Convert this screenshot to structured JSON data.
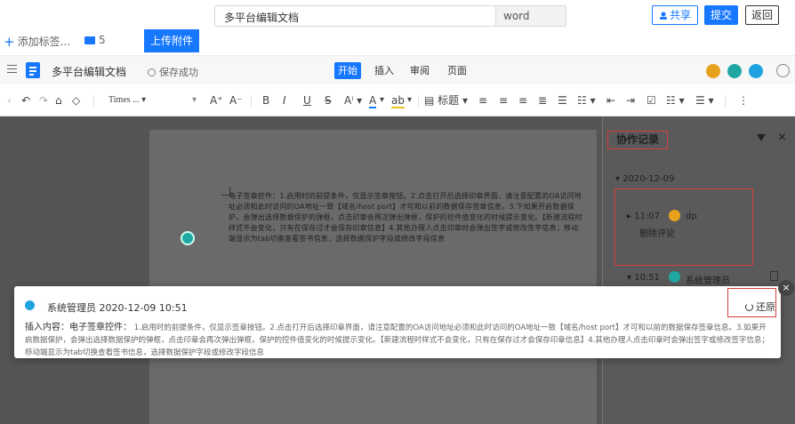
{
  "top": {
    "doc_name": "多平台编辑文档",
    "format": "word",
    "share": "共享",
    "submit": "提交",
    "back": "返回"
  },
  "sub": {
    "add_tag": "添加标签...",
    "folder_count": "5",
    "upload": "上传附件"
  },
  "editor": {
    "title": "多平台编辑文档",
    "save_status": "保存成功",
    "tabs": [
      "开始",
      "插入",
      "审阅",
      "页面"
    ],
    "avatars": [
      {
        "label": "",
        "color": "#e8a11c"
      },
      {
        "label": "",
        "color": "#21a7a3"
      },
      {
        "label": "",
        "color": "#1fa3e0"
      }
    ]
  },
  "toolbar": {
    "font": "Times ...",
    "bold": "B",
    "italic": "I",
    "underline": "U",
    "strike": "S",
    "heading": "标题",
    "grow": "A⁺",
    "shrink": "A⁻"
  },
  "document": {
    "para": "电子签章控件：1.启用时的前提条件，仅显示签章按钮。2.点击打开后选择印章界面，请注意配置的OA访问地址必须和此时访问的OA地址一致【域名/host port】才可和以前的数据保存签章信息。3.下如果开启数据保护，会弹出选择数据保护的弹框，点击印章会再次弹出弹框，保护的控件值变化的时候提示变化。【新建流程时样式不会变化，只有在保存过才会保存印章信息】4.其他办理人点击印章时会弹出签字或修改签字信息；移动端显示为tab切换查看签书信息，选择数据保护字段或修改字段信息"
  },
  "panel": {
    "title": "协作记录",
    "date": "2020-12-09",
    "rec1_time": "11:07",
    "rec1_user": "dp",
    "rec1_action": "删除评论",
    "rec2_time": "10:51",
    "rec2_user": "系统管理员"
  },
  "popover": {
    "user": "系统管理员",
    "datetime": "2020-12-09 10:51",
    "label": "插入内容：电子签章控件：",
    "content": "1.启用时的前提条件，仅显示签章按钮。2.点击打开后选择印章界面，请注意配置的OA访问地址必须和此时访问的OA地址一致【域名/host port】才可和以前的数据保存签章信息。3.如果开启数据保护，会弹出选择数据保护的弹框，点击印章会再次弹出弹框，保护的控件值变化的时候提示变化。【新建流程时样式不会变化，只有在保存过才会保存印章信息】4.其他办理人点击印章时会弹出签字或修改签字信息；移动端显示为tab切换查看签书信息，选择数据保护字段或修改字段信息",
    "restore": "还原"
  },
  "colors": {
    "primary": "#1677ff",
    "highlight_box": "#d43d3d"
  }
}
